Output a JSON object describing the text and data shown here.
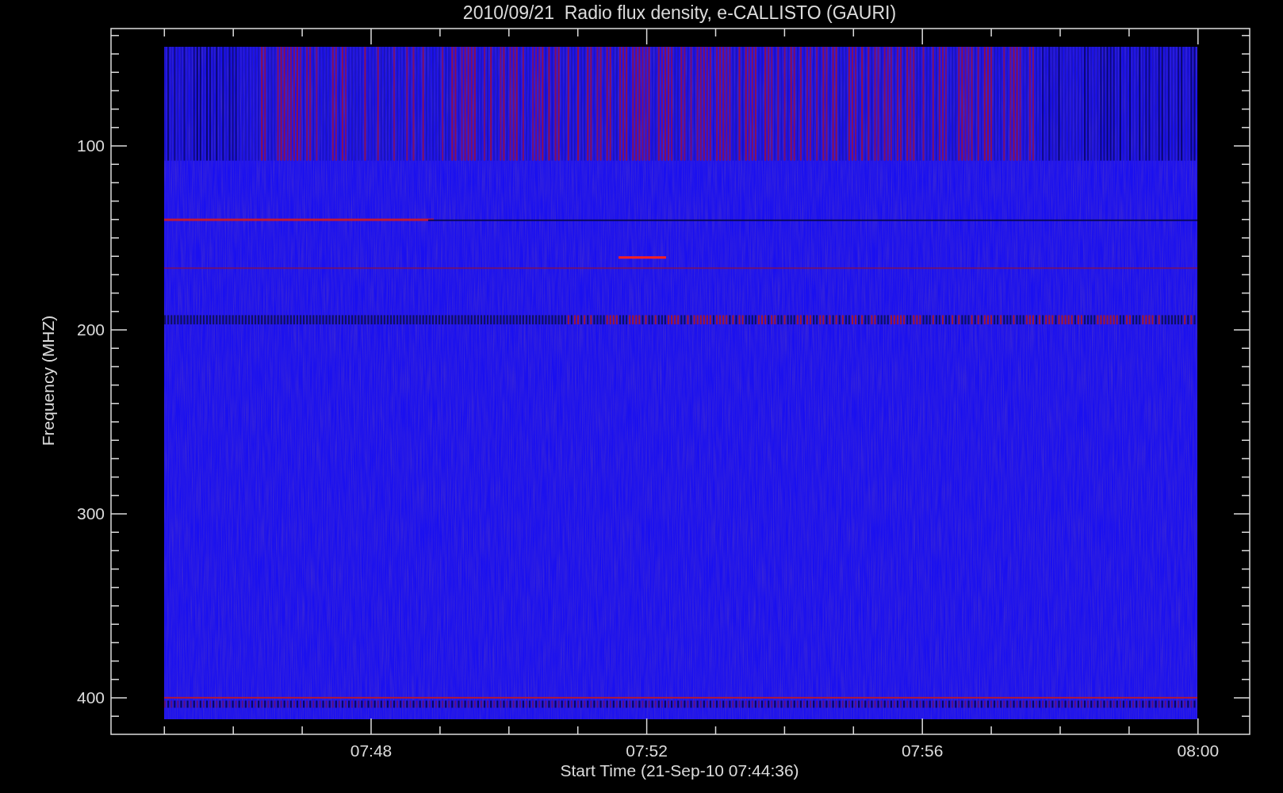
{
  "title": "2010/09/21  Radio flux density, e-CALLISTO (GAURI)",
  "y_axis": {
    "label": "Frequency (MHZ)",
    "ticks": [
      "100",
      "200",
      "300",
      "400"
    ]
  },
  "x_axis": {
    "label": "Start Time (21-Sep-10 07:44:36)",
    "ticks": [
      "07:48",
      "07:52",
      "07:56",
      "08:00"
    ]
  }
}
